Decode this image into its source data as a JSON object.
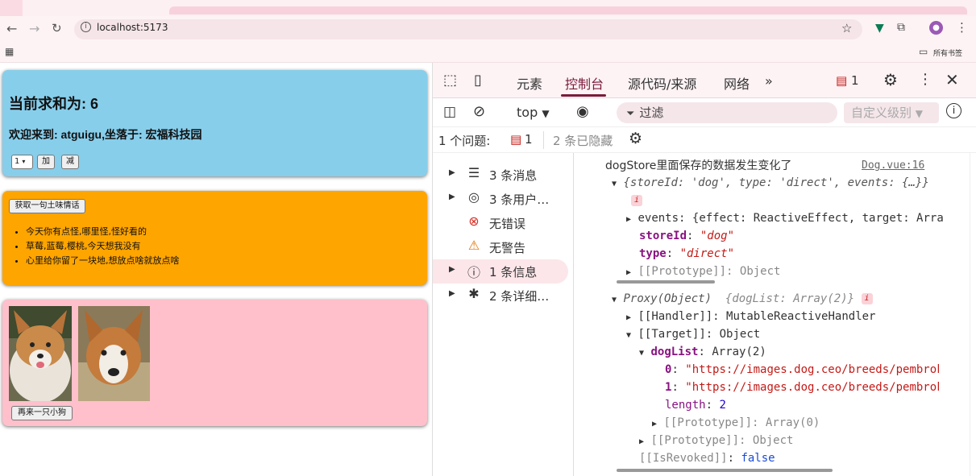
{
  "browser": {
    "url": "localhost:5173",
    "bookmarks_label": "所有书签"
  },
  "app": {
    "sum_heading": "当前求和为: 6",
    "welcome_text": "欢迎来到: atguigu,坐落于: 宏福科技园",
    "select_value": "1",
    "add_label": "加",
    "minus_label": "减",
    "talk_button": "获取一句土味情话",
    "talks": [
      "今天你有点怪,哪里怪,怪好看的",
      "草莓,蓝莓,樱桃,今天想我没有",
      "心里给你留了一块地,想放点啥就放点啥"
    ],
    "dog_button": "再来一只小狗"
  },
  "devtools": {
    "tabs": [
      "元素",
      "控制台",
      "源代码/来源",
      "网络"
    ],
    "active_tab": "控制台",
    "issue_count": "1",
    "context": "top",
    "filter_placeholder": "过滤",
    "levels": "自定义级别",
    "issues_label": "1 个问题:",
    "issues_badge": "1",
    "hidden_label": "2 条已隐藏",
    "sidebar": [
      {
        "label": "3 条消息",
        "icon": "list-icon"
      },
      {
        "label": "3 条用户…",
        "icon": "user-icon"
      },
      {
        "label": "无错误",
        "icon": "error-icon"
      },
      {
        "label": "无警告",
        "icon": "warning-icon"
      },
      {
        "label": "1 条信息",
        "icon": "info-icon"
      },
      {
        "label": "2 条详细…",
        "icon": "bug-icon"
      }
    ],
    "console": {
      "message": "dogStore里面保存的数据发生变化了",
      "source": "Dog.vue:16",
      "obj_summary": "{storeId: 'dog', type: 'direct', events: {…}}",
      "events_line": "events: {effect: ReactiveEffect, target: Arra",
      "storeId_key": "storeId",
      "storeId_val": "\"dog\"",
      "type_key": "type",
      "type_val": "\"direct\"",
      "proto_obj": "[[Prototype]]: Object",
      "proxy_summary": "Proxy(Object)",
      "proxy_detail": "{dogList: Array(2)}",
      "handler_line": "[[Handler]]: MutableReactiveHandler",
      "target_line": "[[Target]]: Object",
      "doglist_key": "dogList",
      "doglist_val": "Array(2)",
      "item0": "\"https://images.dog.ceo/breeds/pembrok",
      "item1": "\"https://images.dog.ceo/breeds/pembrok",
      "length_key": "length",
      "length_val": "2",
      "proto_arr": "[[Prototype]]: Array(0)",
      "proto_obj2": "[[Prototype]]: Object",
      "revoked_key": "[[IsRevoked]]",
      "revoked_val": "false"
    }
  }
}
